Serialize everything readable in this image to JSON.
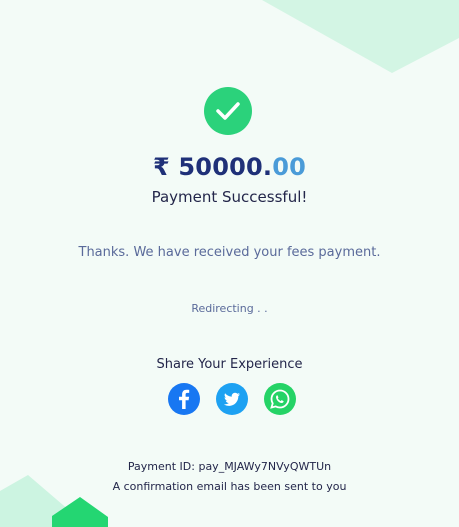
{
  "payment": {
    "currency_symbol": "₹",
    "amount_whole": "50000.",
    "amount_decimal": "00",
    "status": "Payment Successful!"
  },
  "message": {
    "thanks": "Thanks. We have received your fees payment.",
    "redirect": "Redirecting . ."
  },
  "share": {
    "label": "Share Your Experience",
    "icons": [
      "facebook-icon",
      "twitter-icon",
      "whatsapp-icon"
    ]
  },
  "footer": {
    "payment_id_label": "Payment ID: pay_MJAWy7NVyQWTUn",
    "email_note": "A confirmation email has been sent to you"
  },
  "colors": {
    "accent_green": "#2bd27b",
    "amount_navy": "#1f3078",
    "amount_decimal_blue": "#4a9bd8",
    "facebook_blue": "#1877f2",
    "twitter_blue": "#1da1f2",
    "whatsapp_green": "#25d366"
  }
}
